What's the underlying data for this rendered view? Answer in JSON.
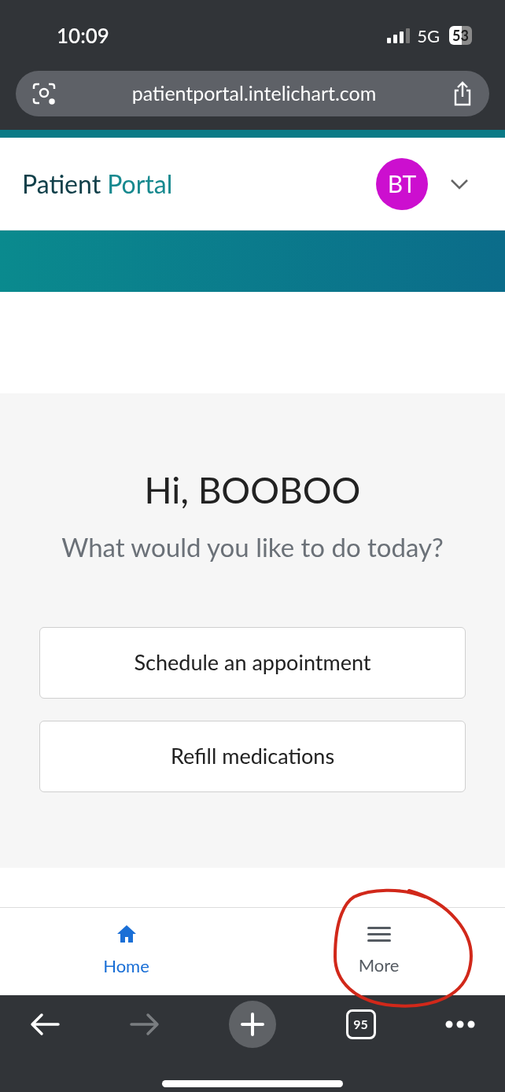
{
  "status_bar": {
    "time": "10:09",
    "network": "5G",
    "battery": "53"
  },
  "browser": {
    "url": "patientportal.intelichart.com",
    "tab_count": "95"
  },
  "header": {
    "brand_first": "Patient",
    "brand_second": "Portal",
    "avatar_initials": "BT"
  },
  "greeting": {
    "title": "Hi, BOOBOO",
    "subtitle": "What would you like to do today?"
  },
  "actions": [
    "Schedule an appointment",
    "Refill medications"
  ],
  "bottom_nav": [
    {
      "kind": "home",
      "label": "Home",
      "selected": true
    },
    {
      "kind": "more",
      "label": "More",
      "selected": false
    }
  ]
}
